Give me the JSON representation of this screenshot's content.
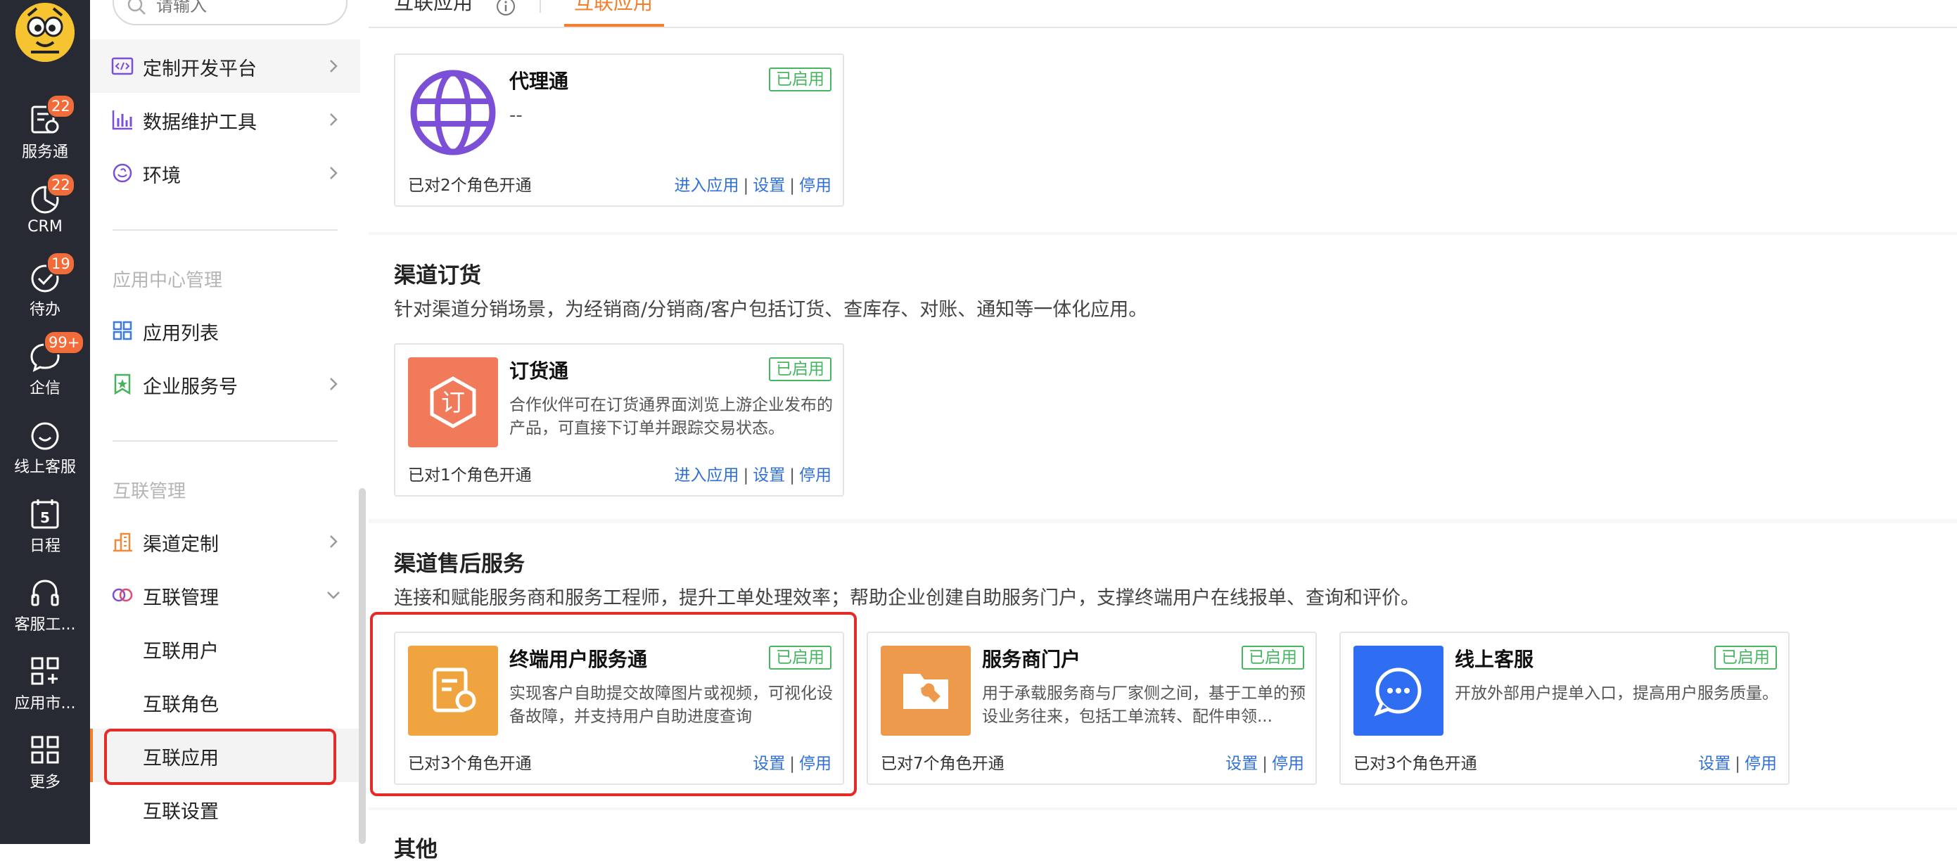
{
  "rail": {
    "items": [
      {
        "label": "服务通",
        "badge": "22",
        "icon": "service-clipboard-icon"
      },
      {
        "label": "CRM",
        "badge": "22",
        "icon": "pie-chart-icon"
      },
      {
        "label": "待办",
        "badge": "19",
        "icon": "check-circle-icon"
      },
      {
        "label": "企信",
        "badge": "99+",
        "icon": "chat-bubble-icon"
      },
      {
        "label": "线上客服",
        "badge": "",
        "icon": "smile-face-icon"
      },
      {
        "label": "日程",
        "badge": "",
        "icon": "calendar-icon"
      },
      {
        "label": "客服工...",
        "badge": "",
        "icon": "headset-icon"
      },
      {
        "label": "应用市...",
        "badge": "",
        "icon": "app-grid-plus-icon"
      },
      {
        "label": "更多",
        "badge": "",
        "icon": "grid-more-icon"
      }
    ]
  },
  "menu": {
    "search_placeholder": "请输入",
    "items_top": [
      {
        "label": "定制开发平台",
        "icon": "code-window-icon"
      },
      {
        "label": "数据维护工具",
        "icon": "bar-chart-icon"
      },
      {
        "label": "环境",
        "icon": "environment-icon"
      }
    ],
    "group_app_center": "应用中心管理",
    "items_app_center": [
      {
        "label": "应用列表",
        "icon": "grid-list-icon"
      },
      {
        "label": "企业服务号",
        "icon": "bookmark-star-icon"
      }
    ],
    "group_interconnect": "互联管理",
    "items_interconnect": [
      {
        "label": "渠道定制",
        "icon": "building-icon"
      },
      {
        "label": "互联管理",
        "icon": "linked-rings-icon"
      }
    ],
    "sub_items": [
      "互联用户",
      "互联角色",
      "互联应用",
      "互联设置"
    ]
  },
  "tabs": {
    "inner": "互联应用",
    "active": "互联应用"
  },
  "top_card": {
    "name": "代理通",
    "status": "已启用",
    "desc": "--",
    "footer": "已对2个角色开通",
    "actions": [
      "进入应用",
      "设置",
      "停用"
    ]
  },
  "section_orders": {
    "title": "渠道订货",
    "desc": "针对渠道分销场景，为经销商/分销商/客户包括订货、查库存、对账、通知等一体化应用。",
    "card": {
      "name": "订货通",
      "status": "已启用",
      "desc": "合作伙伴可在订货通界面浏览上游企业发布的产品，可直接下订单并跟踪交易状态。",
      "footer": "已对1个角色开通",
      "actions": [
        "进入应用",
        "设置",
        "停用"
      ]
    }
  },
  "section_service": {
    "title": "渠道售后服务",
    "desc": "连接和赋能服务商和服务工程师，提升工单处理效率；帮助企业创建自助服务门户，支撑终端用户在线报单、查询和评价。",
    "cards": [
      {
        "name": "终端用户服务通",
        "status": "已启用",
        "desc": "实现客户自助提交故障图片或视频，可视化设备故障，并支持用户自助进度查询",
        "footer": "已对3个角色开通",
        "actions": [
          "设置",
          "停用"
        ]
      },
      {
        "name": "服务商门户",
        "status": "已启用",
        "desc": "用于承载服务商与厂家侧之间，基于工单的预设业务往来，包括工单流转、配件申领...",
        "footer": "已对7个角色开通",
        "actions": [
          "设置",
          "停用"
        ]
      },
      {
        "name": "线上客服",
        "status": "已启用",
        "desc": "开放外部用户提单入口，提高用户服务质量。",
        "footer": "已对3个角色开通",
        "actions": [
          "设置",
          "停用"
        ]
      }
    ]
  },
  "section_other": {
    "title": "其他"
  },
  "colors": {
    "rail_bg": "#272a33",
    "badge": "#f26b3a",
    "accent_orange": "#f77d2b",
    "enabled_green": "#46b661",
    "link_blue": "#2f6fd8",
    "highlight_red": "#e52b28",
    "icon_purple": "#7b4fd6",
    "order_icon_bg": "#f07a5a",
    "service_icon_bg": "#f0a440",
    "portal_icon_bg": "#ee9a4c",
    "chat_icon_bg": "#2f6ef2"
  }
}
